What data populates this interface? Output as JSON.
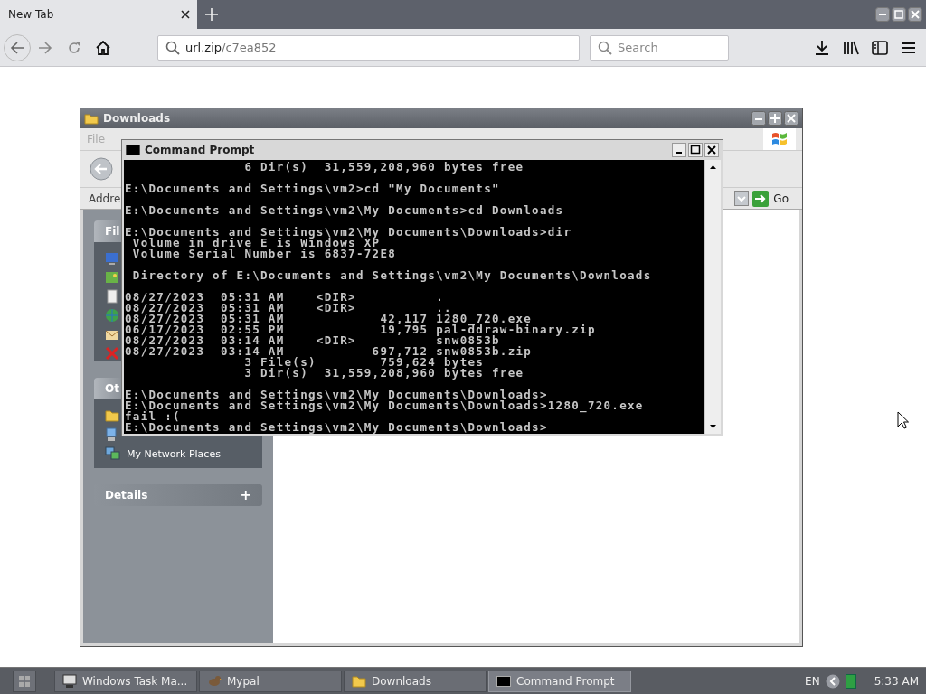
{
  "browser": {
    "tabs": [
      {
        "label": "New Tab",
        "selected": true
      }
    ],
    "url": {
      "host": "url.zip",
      "path": "/c7ea852"
    },
    "search": {
      "placeholder": "Search"
    }
  },
  "explorer_window": {
    "title": "Downloads",
    "menu": [
      "File"
    ],
    "address_label": "Addre",
    "go_button": "Go",
    "panels": [
      {
        "title": "Fil",
        "kind": "tasks"
      },
      {
        "title": "Ot",
        "kind": "places",
        "items": [
          "My Network Places"
        ]
      },
      {
        "title": "Details",
        "kind": "collapsed",
        "toggle": "+"
      }
    ]
  },
  "console_window": {
    "title": "Command Prompt",
    "blocks": [
      [
        "               6 Dir(s)  31,559,208,960 bytes free"
      ],
      [
        "E:\\Documents and Settings\\vm2>cd \"My Documents\""
      ],
      [
        "E:\\Documents and Settings\\vm2\\My Documents>cd Downloads"
      ],
      [
        "E:\\Documents and Settings\\vm2\\My Documents\\Downloads>dir",
        " Volume in drive E is Windows XP",
        " Volume Serial Number is 6837-72E8"
      ],
      [
        " Directory of E:\\Documents and Settings\\vm2\\My Documents\\Downloads"
      ],
      [
        "08/27/2023  05:31 AM    <DIR>          .",
        "08/27/2023  05:31 AM    <DIR>          ..",
        "08/27/2023  05:31 AM            42,117 1280_720.exe",
        "06/17/2023  02:55 PM            19,795 pal-ddraw-binary.zip",
        "08/27/2023  03:14 AM    <DIR>          snw0853b",
        "08/27/2023  03:14 AM           697,712 snw0853b.zip",
        "               3 File(s)        759,624 bytes",
        "               3 Dir(s)  31,559,208,960 bytes free"
      ],
      [
        "E:\\Documents and Settings\\vm2\\My Documents\\Downloads>",
        "E:\\Documents and Settings\\vm2\\My Documents\\Downloads>1280_720.exe",
        "fail :(",
        "E:\\Documents and Settings\\vm2\\My Documents\\Downloads>"
      ]
    ]
  },
  "taskbar": {
    "items": [
      {
        "label": "Windows Task Ma...",
        "kind": "monitor",
        "selected": false
      },
      {
        "label": "Mypal",
        "kind": "browser",
        "selected": false
      },
      {
        "label": "Downloads",
        "kind": "folder",
        "selected": false
      },
      {
        "label": "Command Prompt",
        "kind": "console",
        "selected": true
      }
    ],
    "language": "EN",
    "clock": "5:33 AM"
  }
}
